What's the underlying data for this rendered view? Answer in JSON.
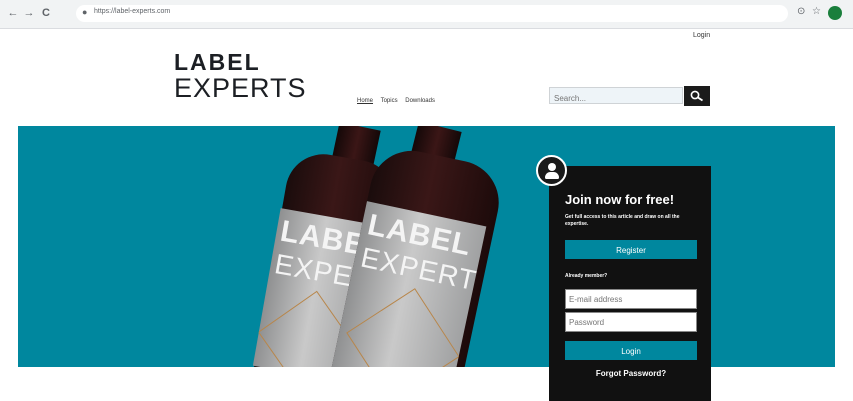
{
  "browser": {
    "url": "https://label-experts.com",
    "back_glyph": "←",
    "forward_glyph": "→",
    "reload_glyph": "C",
    "lock_glyph": "●",
    "star_glyph": "☆",
    "ext_glyph": "⊙"
  },
  "header": {
    "login_link": "Login",
    "logo_line1": "LABEL",
    "logo_line2": "EXPERTS",
    "nav": [
      "Home",
      "Topics",
      "Downloads"
    ],
    "search_placeholder": "Search..."
  },
  "hero": {
    "bottle_label_line1": "LABEL",
    "bottle_label_line2": "EXPERTS",
    "background_color": "#00879e"
  },
  "join_panel": {
    "title": "Join now for free!",
    "description": "Get full access to this article and draw on all the expertise.",
    "register_label": "Register",
    "already_label": "Already member?",
    "email_placeholder": "E-mail address",
    "password_placeholder": "Password",
    "login_label": "Login",
    "forgot_label": "Forgot Password?"
  }
}
